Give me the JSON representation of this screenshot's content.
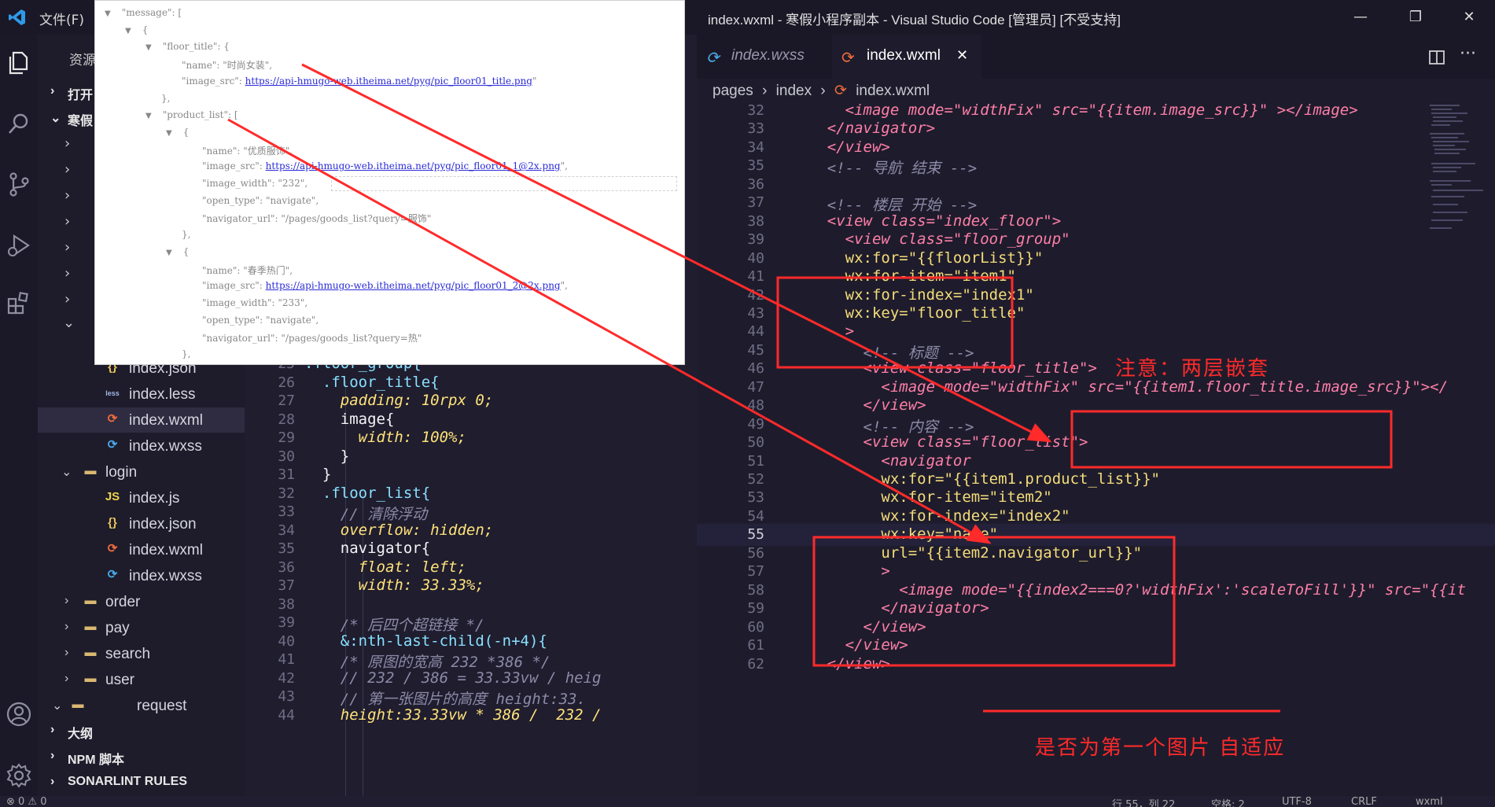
{
  "titlebar": {
    "menu_file": "文件(F)",
    "title": "index.wxml - 寒假小程序副本 - Visual Studio Code [管理员] [不受支持]",
    "minimize": "—",
    "maximize": "❐",
    "close": "✕"
  },
  "activity": {
    "icons": [
      "explorer-icon",
      "search-icon",
      "source-control-icon",
      "run-debug-icon",
      "extensions-icon",
      "account-icon",
      "settings-gear-icon"
    ]
  },
  "sidebar": {
    "header": "资源",
    "open_editors": "打开",
    "project": "寒假",
    "files": [
      {
        "name": "index.json",
        "type": "json"
      },
      {
        "name": "index.less",
        "type": "less"
      },
      {
        "name": "index.wxml",
        "type": "wxml"
      },
      {
        "name": "index.wxss",
        "type": "wxss"
      },
      {
        "name": "login",
        "type": "folder"
      },
      {
        "name": "index.js",
        "type": "js"
      },
      {
        "name": "index.json",
        "type": "json"
      },
      {
        "name": "index.wxml",
        "type": "wxml"
      },
      {
        "name": "index.wxss",
        "type": "wxss"
      },
      {
        "name": "order",
        "type": "folder"
      },
      {
        "name": "pay",
        "type": "folder"
      },
      {
        "name": "search",
        "type": "folder"
      },
      {
        "name": "user",
        "type": "folder"
      },
      {
        "name": "request",
        "type": "folder"
      }
    ],
    "sections": [
      "大纲",
      "NPM 脚本",
      "SONARLINT RULES"
    ]
  },
  "left_editor": {
    "lines": [
      {
        "n": "25",
        "code": ".floor_group{"
      },
      {
        "n": "26",
        "code": "  .floor_title{"
      },
      {
        "n": "27",
        "code": "    padding: 10rpx 0;"
      },
      {
        "n": "28",
        "code": "    image{"
      },
      {
        "n": "29",
        "code": "      width: 100%;"
      },
      {
        "n": "30",
        "code": "    }"
      },
      {
        "n": "31",
        "code": "  }"
      },
      {
        "n": "32",
        "code": "  .floor_list{"
      },
      {
        "n": "33",
        "code": "    // 清除浮动"
      },
      {
        "n": "34",
        "code": "    overflow: hidden;"
      },
      {
        "n": "35",
        "code": "    navigator{"
      },
      {
        "n": "36",
        "code": "      float: left;"
      },
      {
        "n": "37",
        "code": "      width: 33.33%;"
      },
      {
        "n": "38",
        "code": ""
      },
      {
        "n": "39",
        "code": "    /* 后四个超链接 */"
      },
      {
        "n": "40",
        "code": "    &:nth-last-child(-n+4){"
      },
      {
        "n": "41",
        "code": "    /* 原图的宽高 232 *386 */"
      },
      {
        "n": "42",
        "code": "    // 232 / 386 = 33.33vw / heig"
      },
      {
        "n": "43",
        "code": "    // 第一张图片的高度 height:33."
      },
      {
        "n": "44",
        "code": "    height:33.33vw * 386 /  232 /"
      }
    ]
  },
  "tabs": [
    {
      "label": "index.wxss",
      "active": false
    },
    {
      "label": "index.wxml",
      "active": true,
      "close": "✕"
    }
  ],
  "breadcrumb": [
    "pages",
    "index",
    "index.wxml"
  ],
  "right_editor": {
    "current_line": "55",
    "lines": [
      {
        "n": "32",
        "code": "      <image mode=\"widthFix\" src=\"{{item.image_src}}\" ></image>"
      },
      {
        "n": "33",
        "code": "    </navigator>"
      },
      {
        "n": "34",
        "code": "    </view>"
      },
      {
        "n": "35",
        "code": "    <!-- 导航 结束 -->"
      },
      {
        "n": "36",
        "code": ""
      },
      {
        "n": "37",
        "code": "    <!-- 楼层 开始 -->"
      },
      {
        "n": "38",
        "code": "    <view class=\"index_floor\">"
      },
      {
        "n": "39",
        "code": "      <view class=\"floor_group\""
      },
      {
        "n": "40",
        "code": "      wx:for=\"{{floorList}}\""
      },
      {
        "n": "41",
        "code": "      wx:for-item=\"item1\""
      },
      {
        "n": "42",
        "code": "      wx:for-index=\"index1\""
      },
      {
        "n": "43",
        "code": "      wx:key=\"floor_title\""
      },
      {
        "n": "44",
        "code": "      >"
      },
      {
        "n": "45",
        "code": "        <!-- 标题 -->"
      },
      {
        "n": "46",
        "code": "        <view class=\"floor_title\">"
      },
      {
        "n": "47",
        "code": "          <image mode=\"widthFix\" src=\"{{item1.floor_title.image_src}}\"></"
      },
      {
        "n": "48",
        "code": "        </view>"
      },
      {
        "n": "49",
        "code": "        <!-- 内容 -->"
      },
      {
        "n": "50",
        "code": "        <view class=\"floor_list\">"
      },
      {
        "n": "51",
        "code": "          <navigator"
      },
      {
        "n": "52",
        "code": "          wx:for=\"{{item1.product_list}}\""
      },
      {
        "n": "53",
        "code": "          wx:for-item=\"item2\""
      },
      {
        "n": "54",
        "code": "          wx:for-index=\"index2\""
      },
      {
        "n": "55",
        "code": "          wx:key=\"name\""
      },
      {
        "n": "56",
        "code": "          url=\"{{item2.navigator_url}}\""
      },
      {
        "n": "57",
        "code": "          >"
      },
      {
        "n": "58",
        "code": "            <image mode=\"{{index2===0?'widthFix':'scaleToFill'}}\" src=\"{{it"
      },
      {
        "n": "59",
        "code": "          </navigator>"
      },
      {
        "n": "60",
        "code": "        </view>"
      },
      {
        "n": "61",
        "code": "      </view>"
      },
      {
        "n": "62",
        "code": "    </view>"
      }
    ]
  },
  "json_popup": {
    "lines": [
      {
        "t": "\"message\":  [",
        "tri": "▼",
        "indent": 0
      },
      {
        "t": "{",
        "tri": "▼",
        "indent": 1
      },
      {
        "t": "\"floor_title\":  {",
        "tri": "▼",
        "indent": 2
      },
      {
        "t": "\"name\":  \"时尚女装\",",
        "tri": "",
        "indent": 3
      },
      {
        "t": "\"image_src\":  ",
        "url": "https://api-hmugo-web.itheima.net/pyg/pic_floor01_title.png",
        "tri": "",
        "indent": 3
      },
      {
        "t": "},",
        "tri": "",
        "indent": 2
      },
      {
        "t": "\"product_list\":  [",
        "tri": "▼",
        "indent": 2
      },
      {
        "t": "{",
        "tri": "▼",
        "indent": 3
      },
      {
        "t": "\"name\":  \"优质服饰\",",
        "tri": "",
        "indent": 4
      },
      {
        "t": "\"image_src\":  ",
        "url": "https://api-hmugo-web.itheima.net/pyg/pic_floor01_1@2x.png",
        "tri": "",
        "indent": 4
      },
      {
        "t": "\"image_width\":  \"232\",",
        "tri": "",
        "indent": 4
      },
      {
        "t": "\"open_type\":  \"navigate\",",
        "tri": "",
        "indent": 4
      },
      {
        "t": "\"navigator_url\":  \"/pages/goods_list?query=服饰\"",
        "tri": "",
        "indent": 4
      },
      {
        "t": "},",
        "tri": "",
        "indent": 3
      },
      {
        "t": "{",
        "tri": "▼",
        "indent": 3
      },
      {
        "t": "\"name\":  \"春季热门\",",
        "tri": "",
        "indent": 4
      },
      {
        "t": "\"image_src\":  ",
        "url": "https://api-hmugo-web.itheima.net/pyg/pic_floor01_2@2x.png",
        "tri": "",
        "indent": 4
      },
      {
        "t": "\"image_width\":  \"233\",",
        "tri": "",
        "indent": 4
      },
      {
        "t": "\"open_type\":  \"navigate\",",
        "tri": "",
        "indent": 4
      },
      {
        "t": "\"navigator_url\":  \"/pages/goods_list?query=热\"",
        "tri": "",
        "indent": 4
      },
      {
        "t": "},",
        "tri": "",
        "indent": 3
      }
    ]
  },
  "annotations": {
    "note_nested": "注意：两层嵌套",
    "note_first_image": "是否为第一个图片   自适应",
    "color": "#ff2a2a"
  },
  "statusbar": {
    "left": "⊗ 0 ⚠ 0",
    "position": "行 55，列 22",
    "spaces": "空格: 2",
    "encoding": "UTF-8",
    "eol": "CRLF",
    "language": "wxml"
  }
}
